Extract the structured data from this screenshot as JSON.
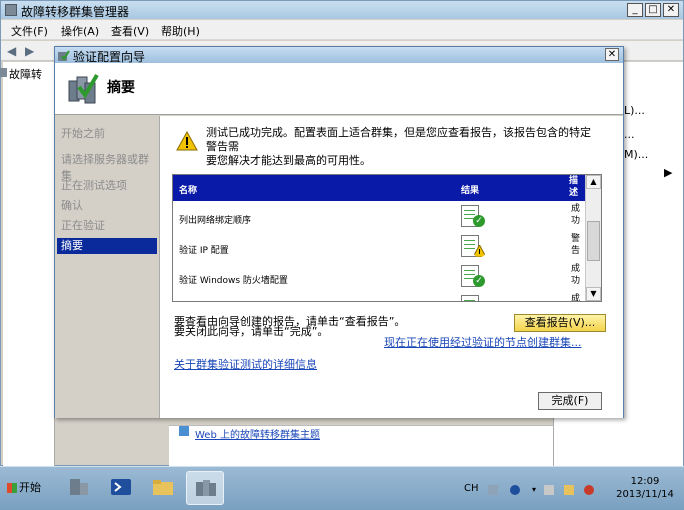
{
  "main_window": {
    "title": "故障转移群集管理器",
    "menu": [
      "文件(F)",
      "操作(A)",
      "查看(V)",
      "帮助(H)"
    ],
    "tree_root": "故障转",
    "actions_partial": [
      "L)...",
      "...",
      "M)..."
    ]
  },
  "background_link": "Web 上的故障转移群集主题",
  "dialog": {
    "title": "验证配置向导",
    "header": "摘要",
    "close": "✕",
    "steps": [
      "开始之前",
      "请选择服务器或群集",
      "正在测试选项",
      "确认",
      "正在验证",
      "摘要"
    ],
    "warning_line1": "测试已成功完成。配置表面上适合群集，但是您应查看报告，该报告包含的特定警告需",
    "warning_line2": "要您解决才能达到最高的可用性。",
    "list": {
      "headers": {
        "name": "名称",
        "result": "结果",
        "desc": "描述"
      },
      "rows": [
        {
          "name": "列出网络绑定顺序",
          "status": "成功",
          "kind": "ok"
        },
        {
          "name": "验证 IP 配置",
          "status": "警告",
          "kind": "warn"
        },
        {
          "name": "验证 Windows 防火墙配置",
          "status": "成功",
          "kind": "ok"
        },
        {
          "name": "",
          "status": "成",
          "kind": "ok"
        }
      ]
    },
    "instr1": "要查看由向导创建的报告，请单击“查看报告”。",
    "instr2": "要关闭此向导，请单击“完成”。",
    "view_report": "查看报告(V)...",
    "create_cluster_link": "现在正在使用经过验证的节点创建群集...",
    "details_link": "关于群集验证测试的详细信息",
    "finish": "完成(F)"
  },
  "taskbar": {
    "start": "开始",
    "lang": "CH",
    "time": "12:09",
    "date": "2013/11/14"
  },
  "colors": {
    "selected_step": "#0a2a9c",
    "list_header": "#0a1aa8",
    "ok": "#2e9a2e",
    "warn": "#e8b400",
    "link": "#1a47b8"
  }
}
